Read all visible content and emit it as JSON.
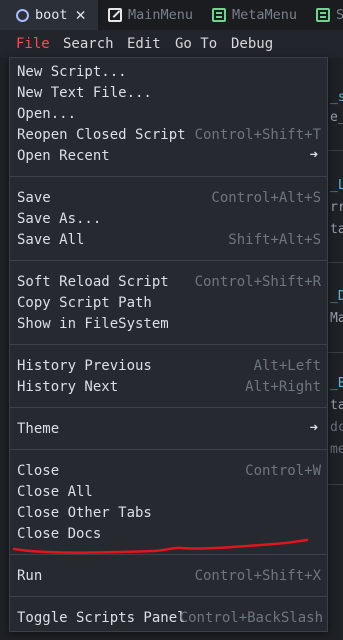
{
  "tabs": [
    {
      "label": "boot",
      "icon": "script-circle-icon",
      "active": true,
      "closable": true
    },
    {
      "label": "MainMenu",
      "icon": "edit-script-icon",
      "active": false
    },
    {
      "label": "MetaMenu",
      "icon": "doc-icon",
      "active": false
    },
    {
      "label": "S",
      "icon": "doc-icon",
      "active": false
    }
  ],
  "menubar": [
    "File",
    "Search",
    "Edit",
    "Go To",
    "Debug"
  ],
  "menubar_active": "File",
  "background_code": [
    "_s",
    "e_",
    "_L",
    "rr",
    "ta",
    "_D",
    "Ma",
    "_B",
    "ta",
    "dc",
    "me"
  ],
  "menu": {
    "groups": [
      [
        {
          "label": "New Script...",
          "shortcut": ""
        },
        {
          "label": "New Text File...",
          "shortcut": ""
        },
        {
          "label": "Open...",
          "shortcut": ""
        },
        {
          "label": "Reopen Closed Script",
          "shortcut": "Control+Shift+T"
        },
        {
          "label": "Open Recent",
          "shortcut": "",
          "submenu": true
        }
      ],
      [
        {
          "label": "Save",
          "shortcut": "Control+Alt+S"
        },
        {
          "label": "Save As...",
          "shortcut": ""
        },
        {
          "label": "Save All",
          "shortcut": "Shift+Alt+S"
        }
      ],
      [
        {
          "label": "Soft Reload Script",
          "shortcut": "Control+Shift+R"
        },
        {
          "label": "Copy Script Path",
          "shortcut": ""
        },
        {
          "label": "Show in FileSystem",
          "shortcut": ""
        }
      ],
      [
        {
          "label": "History Previous",
          "shortcut": "Alt+Left"
        },
        {
          "label": "History Next",
          "shortcut": "Alt+Right"
        }
      ],
      [
        {
          "label": "Theme",
          "shortcut": "",
          "submenu": true
        }
      ],
      [
        {
          "label": "Close",
          "shortcut": "Control+W"
        },
        {
          "label": "Close All",
          "shortcut": ""
        },
        {
          "label": "Close Other Tabs",
          "shortcut": ""
        },
        {
          "label": "Close Docs",
          "shortcut": ""
        }
      ],
      [
        {
          "label": "Run",
          "shortcut": "Control+Shift+X"
        }
      ],
      [
        {
          "label": "Toggle Scripts Panel",
          "shortcut": "Control+BackSlash"
        }
      ]
    ]
  },
  "colors": {
    "accent_red": "#ff4a4a",
    "annotation_red": "#e0151d",
    "cyan_code": "#5fb7d0"
  }
}
